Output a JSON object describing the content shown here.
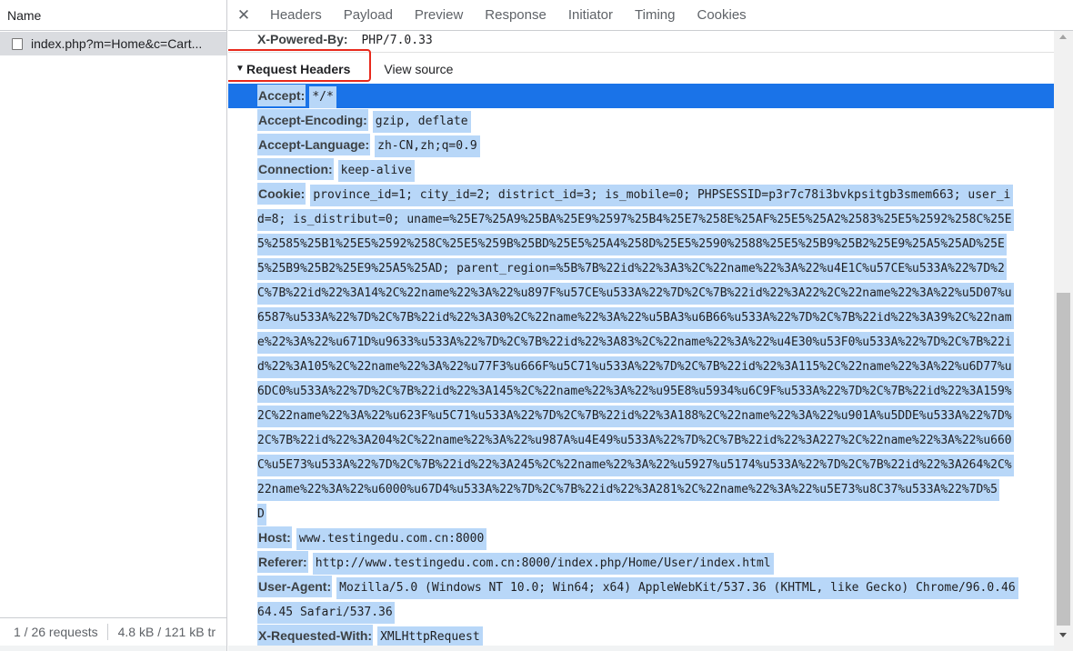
{
  "network_list": {
    "column_header": "Name",
    "request_name": "index.php?m=Home&c=Cart...",
    "footer_requests": "1 / 26 requests",
    "footer_transferred": "4.8 kB / 121 kB tr"
  },
  "tabs": [
    "Headers",
    "Payload",
    "Preview",
    "Response",
    "Initiator",
    "Timing",
    "Cookies"
  ],
  "active_tab": "Headers",
  "previous_header": {
    "name": "X-Powered-By:",
    "value": "PHP/7.0.33"
  },
  "section": {
    "title": "Request Headers",
    "view_source": "View source"
  },
  "request_headers": [
    {
      "name": "Accept:",
      "lines": [
        "*/*"
      ]
    },
    {
      "name": "Accept-Encoding:",
      "lines": [
        "gzip, deflate"
      ]
    },
    {
      "name": "Accept-Language:",
      "lines": [
        "zh-CN,zh;q=0.9"
      ]
    },
    {
      "name": "Connection:",
      "lines": [
        "keep-alive"
      ]
    },
    {
      "name": "Cookie:",
      "lines": [
        "province_id=1; city_id=2; district_id=3; is_mobile=0; PHPSESSID=p3r7c78i3bvkpsitgb3smem663; user_i",
        "d=8; is_distribut=0; uname=%25E7%25A9%25BA%25E9%2597%25B4%25E7%258E%25AF%25E5%25A2%2583%25E5%2592%258C%25E",
        "5%2585%25B1%25E5%2592%258C%25E5%259B%25BD%25E5%25A4%258D%25E5%2590%2588%25E5%25B9%25B2%25E9%25A5%25AD%25E",
        "5%25B9%25B2%25E9%25A5%25AD; parent_region=%5B%7B%22id%22%3A3%2C%22name%22%3A%22%u4E1C%u57CE%u533A%22%7D%2",
        "C%7B%22id%22%3A14%2C%22name%22%3A%22%u897F%u57CE%u533A%22%7D%2C%7B%22id%22%3A22%2C%22name%22%3A%22%u5D07%u",
        "6587%u533A%22%7D%2C%7B%22id%22%3A30%2C%22name%22%3A%22%u5BA3%u6B66%u533A%22%7D%2C%7B%22id%22%3A39%2C%22nam",
        "e%22%3A%22%u671D%u9633%u533A%22%7D%2C%7B%22id%22%3A83%2C%22name%22%3A%22%u4E30%u53F0%u533A%22%7D%2C%7B%22i",
        "d%22%3A105%2C%22name%22%3A%22%u77F3%u666F%u5C71%u533A%22%7D%2C%7B%22id%22%3A115%2C%22name%22%3A%22%u6D77%u",
        "6DC0%u533A%22%7D%2C%7B%22id%22%3A145%2C%22name%22%3A%22%u95E8%u5934%u6C9F%u533A%22%7D%2C%7B%22id%22%3A159%",
        "2C%22name%22%3A%22%u623F%u5C71%u533A%22%7D%2C%7B%22id%22%3A188%2C%22name%22%3A%22%u901A%u5DDE%u533A%22%7D%",
        "2C%7B%22id%22%3A204%2C%22name%22%3A%22%u987A%u4E49%u533A%22%7D%2C%7B%22id%22%3A227%2C%22name%22%3A%22%u660",
        "C%u5E73%u533A%22%7D%2C%7B%22id%22%3A245%2C%22name%22%3A%22%u5927%u5174%u533A%22%7D%2C%7B%22id%22%3A264%2C%",
        "22name%22%3A%22%u6000%u67D4%u533A%22%7D%2C%7B%22id%22%3A281%2C%22name%22%3A%22%u5E73%u8C37%u533A%22%7D%5",
        "D"
      ]
    },
    {
      "name": "Host:",
      "lines": [
        "www.testingedu.com.cn:8000"
      ]
    },
    {
      "name": "Referer:",
      "lines": [
        "http://www.testingedu.com.cn:8000/index.php/Home/User/index.html"
      ]
    },
    {
      "name": "User-Agent:",
      "lines": [
        "Mozilla/5.0 (Windows NT 10.0; Win64; x64) AppleWebKit/537.36 (KHTML, like Gecko) Chrome/96.0.46",
        "64.45 Safari/537.36"
      ]
    },
    {
      "name": "X-Requested-With:",
      "lines": [
        "XMLHttpRequest"
      ]
    }
  ],
  "selected_header_index": 0,
  "icons": {
    "close": "close-icon",
    "expand": "triangle-down-icon",
    "checkbox": "checkbox-icon"
  },
  "colors": {
    "selection": "#1a73e8",
    "highlight": "#b8d7f8",
    "annotation_box": "#e8291c"
  }
}
